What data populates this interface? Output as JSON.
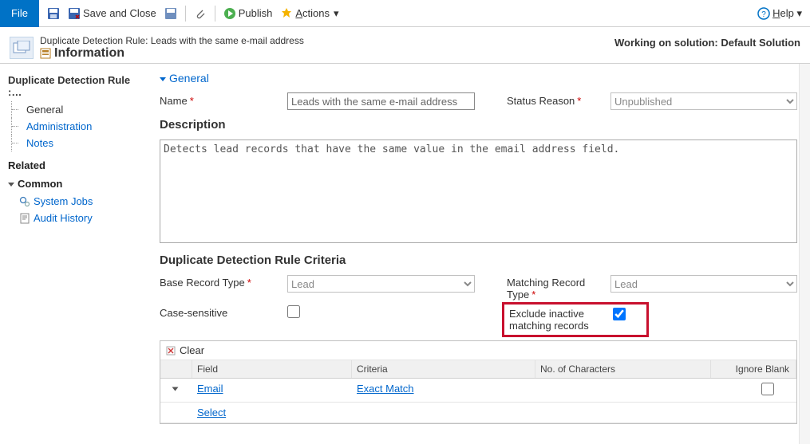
{
  "ribbon": {
    "file": "File",
    "save_close": "Save and Close",
    "publish": "Publish",
    "actions": "Actions",
    "help": "Help"
  },
  "header": {
    "rule_line": "Duplicate Detection Rule: Leads with the same e-mail address",
    "info": "Information",
    "status": "Working on solution: Default Solution"
  },
  "sidebar": {
    "title": "Duplicate Detection Rule :…",
    "items": [
      "General",
      "Administration",
      "Notes"
    ],
    "related": "Related",
    "common": "Common",
    "rel_items": [
      "System Jobs",
      "Audit History"
    ]
  },
  "general": {
    "section": "General",
    "name_label": "Name",
    "name_value": "Leads with the same e-mail address",
    "status_label": "Status Reason",
    "status_value": "Unpublished",
    "desc_label": "Description",
    "desc_value": "Detects lead records that have the same value in the email address field."
  },
  "criteria": {
    "section": "Duplicate Detection Rule Criteria",
    "base_label": "Base Record Type",
    "base_value": "Lead",
    "match_label": "Matching Record Type",
    "match_value": "Lead",
    "case_label": "Case-sensitive",
    "exclude_label": "Exclude inactive matching records"
  },
  "grid": {
    "clear": "Clear",
    "cols": {
      "field": "Field",
      "criteria": "Criteria",
      "nchars": "No. of Characters",
      "ignore": "Ignore Blank"
    },
    "row1": {
      "field": "Email",
      "criteria": "Exact Match"
    },
    "row2": {
      "field": "Select"
    }
  }
}
